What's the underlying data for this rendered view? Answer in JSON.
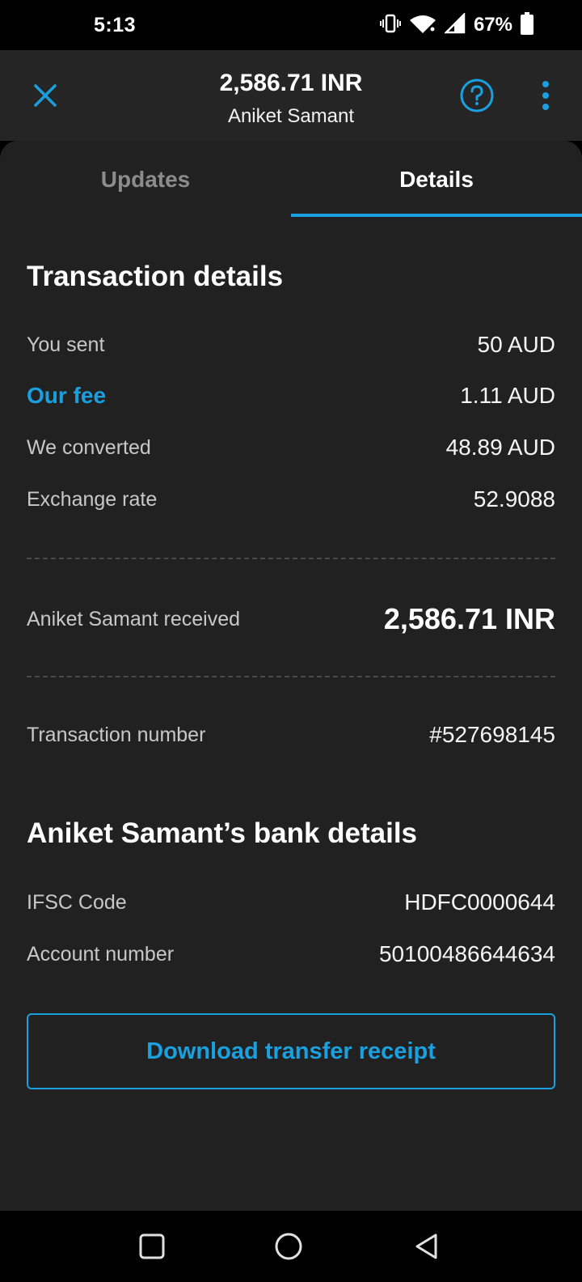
{
  "status_bar": {
    "time": "5:13",
    "battery": "67%",
    "icons": [
      "vibrate-icon",
      "wifi-icon",
      "signal-icon",
      "battery-icon"
    ]
  },
  "header": {
    "title": "2,586.71 INR",
    "subtitle": "Aniket Samant",
    "icons": [
      "close-icon",
      "help-icon",
      "more-vert-icon"
    ]
  },
  "tabs": [
    {
      "label": "Updates",
      "selected": false
    },
    {
      "label": "Details",
      "selected": true
    }
  ],
  "transaction": {
    "title": "Transaction details",
    "rows": [
      {
        "label": "You sent",
        "value": "50 AUD"
      },
      {
        "label": "Our fee",
        "value": "1.11 AUD"
      },
      {
        "label": "We converted",
        "value": "48.89 AUD"
      },
      {
        "label": "Exchange rate",
        "value": "52.9088"
      }
    ],
    "received_label": "Aniket Samant received",
    "received_value": "2,586.71 INR",
    "number_label": "Transaction number",
    "number_value": "#527698145"
  },
  "bank": {
    "title": "Aniket Samant’s bank details",
    "rows": [
      {
        "label": "IFSC Code",
        "value": "HDFC0000644"
      },
      {
        "label": "Account number",
        "value": "50100486644634"
      }
    ]
  },
  "download_button": "Download transfer receipt",
  "nav": [
    "recents-icon",
    "home-icon",
    "back-icon"
  ],
  "colors": {
    "accent": "#1aa0de",
    "background": "#212121",
    "header": "#252525"
  }
}
